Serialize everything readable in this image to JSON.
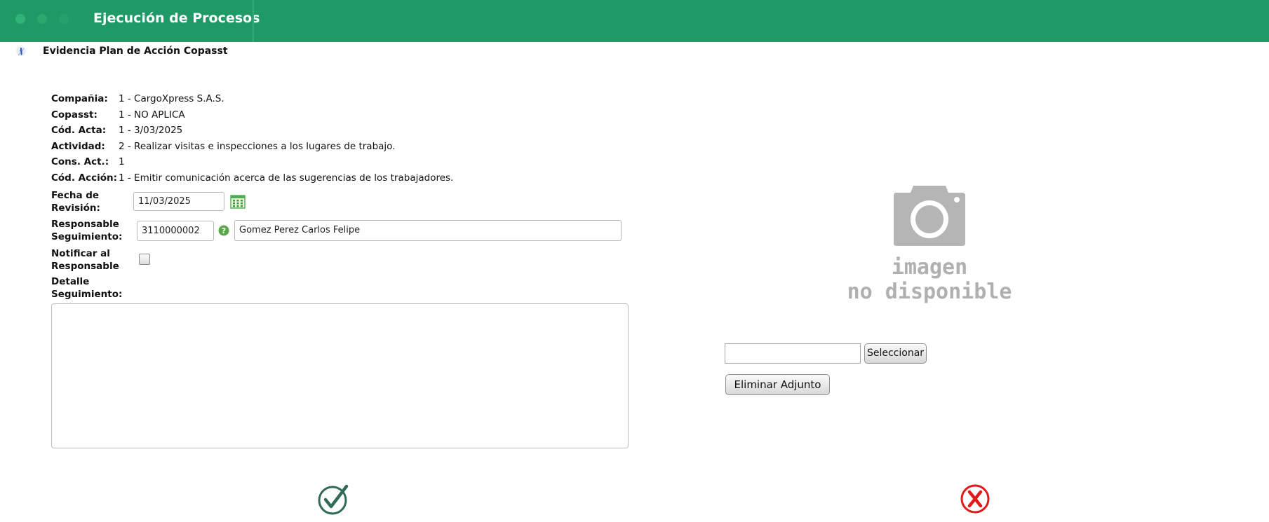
{
  "header": {
    "title": "Ejecución de Procesos"
  },
  "page": {
    "title": "Evidencia Plan de Acción Copasst"
  },
  "fields": {
    "compania": {
      "label": "Compañia:",
      "value": "1 - CargoXpress S.A.S."
    },
    "copasst": {
      "label": "Copasst:",
      "value": "1 - NO APLICA"
    },
    "cod_acta": {
      "label": "Cód. Acta:",
      "value": "1 - 3/03/2025"
    },
    "actividad": {
      "label": "Actividad:",
      "value": "2 - Realizar visitas e inspecciones a los lugares de trabajo."
    },
    "cons_act": {
      "label": "Cons. Act.:",
      "value": "1"
    },
    "cod_accion": {
      "label": "Cód. Acción:",
      "value": "1 - Emitir comunicación acerca de las sugerencias de los trabajadores."
    }
  },
  "form": {
    "fecha_revision": {
      "label_line1": "Fecha de",
      "label_line2": "Revisión:",
      "value": "11/03/2025"
    },
    "responsable": {
      "label_line1": "Responsable",
      "label_line2": "Seguimiento:",
      "code": "3110000002",
      "name": "Gomez Perez Carlos Felipe"
    },
    "notificar": {
      "label_line1": "Notificar al",
      "label_line2": "Responsable",
      "checked": false
    },
    "detalle": {
      "label_line1": "Detalle",
      "label_line2": "Seguimiento:",
      "value": ""
    }
  },
  "attachment": {
    "placeholder_line1": "imagen",
    "placeholder_line2": "no disponible",
    "select_label": "Seleccionar",
    "delete_label": "Eliminar Adjunto"
  },
  "icons": {
    "info": "info-icon",
    "calendar": "calendar-icon",
    "help": "help-icon",
    "camera": "camera-icon",
    "accept": "check-circle-icon",
    "cancel": "x-circle-icon"
  },
  "colors": {
    "header": "#1f9a66",
    "accept": "#2f6b55",
    "cancel": "#e01a1a"
  }
}
